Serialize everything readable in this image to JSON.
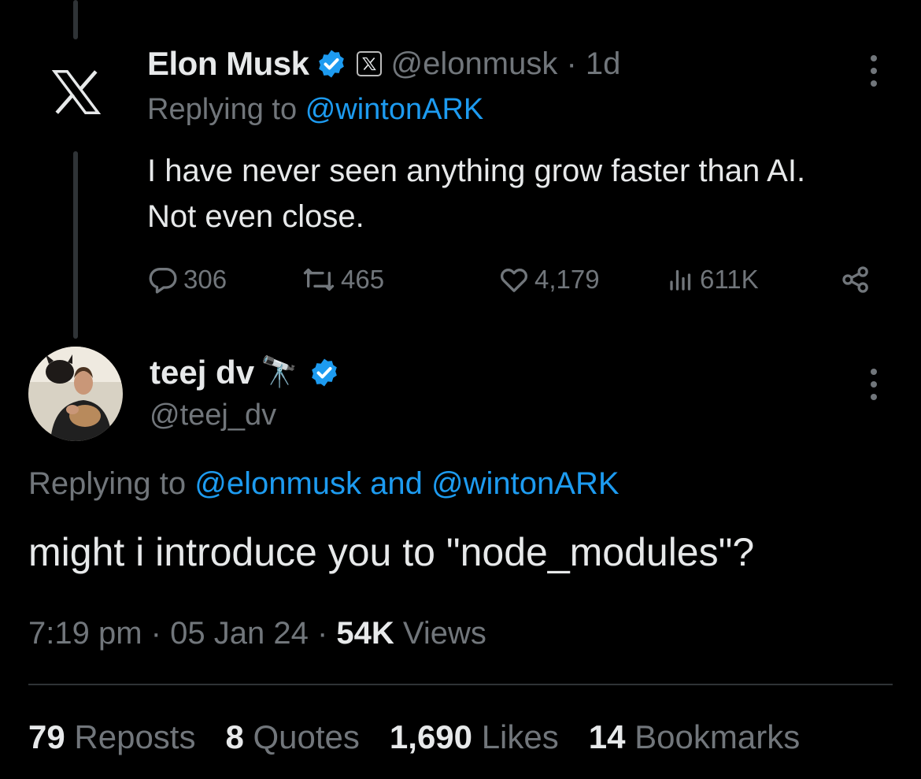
{
  "tweet1": {
    "name": "Elon Musk",
    "handle": "@elonmusk",
    "sep": "·",
    "time": "1d",
    "replying_prefix": "Replying to",
    "replying_to": "@wintonARK",
    "body_line1": "I have never seen anything grow faster than AI.",
    "body_line2": "Not even close.",
    "replies": "306",
    "reposts": "465",
    "likes": "4,179",
    "views": "611K",
    "icons": [
      "x-logo-icon",
      "verified-badge-icon",
      "x-affiliate-icon",
      "more-icon",
      "reply-icon",
      "repost-icon",
      "like-icon",
      "views-icon",
      "share-icon"
    ]
  },
  "tweet2": {
    "name": "teej dv",
    "emoji": "🔭",
    "handle": "@teej_dv",
    "replying_prefix": "Replying to",
    "replying_to_1": "@elonmusk",
    "replying_and": "and",
    "replying_to_2": "@wintonARK",
    "body": "might i introduce you to \"node_modules\"?",
    "time": "7:19 pm",
    "sep": "·",
    "date": "05 Jan 24",
    "views_count": "54K",
    "views_label": "Views"
  },
  "stats": [
    {
      "value": "79",
      "label": "Reposts"
    },
    {
      "value": "8",
      "label": "Quotes"
    },
    {
      "value": "1,690",
      "label": "Likes"
    },
    {
      "value": "14",
      "label": "Bookmarks"
    }
  ],
  "colors": {
    "background": "#000000",
    "text": "#e7e9ea",
    "muted": "#71767b",
    "accent": "#1d9bf0",
    "divider": "#2f3336"
  }
}
